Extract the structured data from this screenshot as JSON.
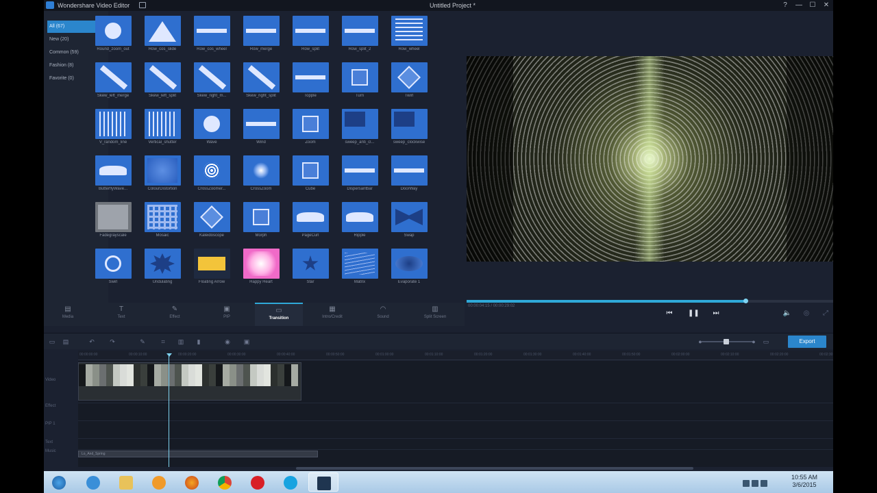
{
  "titlebar": {
    "app_title": "Wondershare Video Editor",
    "project_title": "Untitled Project *",
    "minimize": "—",
    "restore": "☐",
    "close": "✕",
    "help": "?"
  },
  "sidebar": {
    "items": [
      {
        "label": "All (67)",
        "active": true
      },
      {
        "label": "New (20)",
        "active": false
      },
      {
        "label": "Common (59)",
        "active": false
      },
      {
        "label": "Fashion (8)",
        "active": false
      },
      {
        "label": "Favorite (0)",
        "active": false
      }
    ]
  },
  "transitions": [
    "Round_zoom_out",
    "Row_cos_slide",
    "Row_cos_wheel",
    "Row_merge",
    "Row_split",
    "Row_split_2",
    "Row_wheel",
    "Skew_left_merge",
    "Skew_left_split",
    "Skew_right_m...",
    "Skew_right_split",
    "Topple",
    "Turn",
    "Twirl",
    "V_random_line",
    "Vertical_shutter",
    "Wave",
    "Wind",
    "Zoom",
    "sweep_anti_cl...",
    "sweep_clockwise",
    "ButterflyWave...",
    "ColourDistortion",
    "CrossZoomer...",
    "CrossZoom",
    "Cube",
    "Dispersantbar",
    "DoorWay",
    "Fadegrayscale",
    "Mosaic",
    "Kaleidoscope",
    "Morph",
    "PageCurl",
    "Ripple",
    "Swap",
    "Swirl",
    "Undulating",
    "Floating Arrow",
    "Happy Heart",
    "Star",
    "Matrix",
    "Evaporate 1"
  ],
  "toolbar": {
    "items": [
      {
        "label": "Media",
        "icon": "media-icon"
      },
      {
        "label": "Text",
        "icon": "text-icon"
      },
      {
        "label": "Effect",
        "icon": "effect-icon"
      },
      {
        "label": "PIP",
        "icon": "pip-icon"
      },
      {
        "label": "Transition",
        "icon": "transition-icon"
      },
      {
        "label": "Intro/Credit",
        "icon": "intro-credit-icon"
      },
      {
        "label": "Sound",
        "icon": "sound-icon"
      },
      {
        "label": "Split Screen",
        "icon": "split-screen-icon"
      }
    ],
    "active_index": 4
  },
  "preview": {
    "timecode": "00:00:04:15 / 00:00:29:02",
    "progress": 0.76,
    "prev_label": "⏮",
    "pause_label": "❚❚",
    "next_label": "⏭",
    "volume_label": "🔈",
    "snapshot_label": "◎",
    "fullscreen_label": "⤢"
  },
  "timeline": {
    "export_label": "Export",
    "ruler_ticks": [
      "00:00:00:00",
      "00:00:10:00",
      "00:00:20:00",
      "00:00:30:00",
      "00:00:40:00",
      "00:00:50:00",
      "00:01:00:00",
      "00:01:10:00",
      "00:01:20:00",
      "00:01:30:00",
      "00:01:40:00",
      "00:01:50:00",
      "00:02:00:00",
      "00:02:10:00",
      "00:02:20:00",
      "00:02:30:00"
    ],
    "tracks": [
      "Video",
      "Effect",
      "PIP 1",
      "Text",
      "Music"
    ],
    "audio_clip_label": "Lo_And_Spring"
  },
  "taskbar": {
    "time": "10:55 AM",
    "date": "3/6/2015"
  },
  "colors": {
    "accent": "#2b86cc",
    "panel": "#1b2130",
    "tile": "#2f6fcf"
  }
}
